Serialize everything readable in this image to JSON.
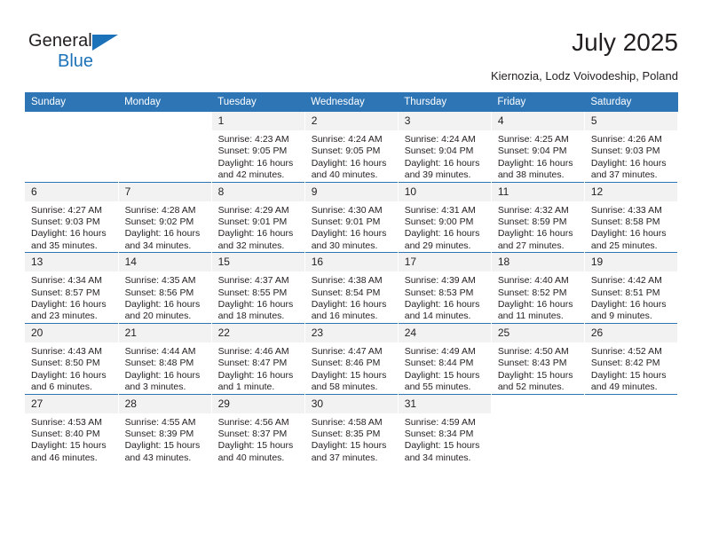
{
  "brand": {
    "name_part1": "General",
    "name_part2": "Blue",
    "accent_color": "#1b72b8",
    "triangle_icon": "brand-triangle-icon"
  },
  "header": {
    "title": "July 2025",
    "subtitle": "Kiernozia, Lodz Voivodeship, Poland"
  },
  "calendar": {
    "header_color": "#2e75b6",
    "daynum_band_color": "#f2f2f2",
    "weekdays": [
      "Sunday",
      "Monday",
      "Tuesday",
      "Wednesday",
      "Thursday",
      "Friday",
      "Saturday"
    ],
    "weeks": [
      [
        {
          "empty": true
        },
        {
          "empty": true
        },
        {
          "day": "1",
          "sunrise": "Sunrise: 4:23 AM",
          "sunset": "Sunset: 9:05 PM",
          "daylight": "Daylight: 16 hours and 42 minutes."
        },
        {
          "day": "2",
          "sunrise": "Sunrise: 4:24 AM",
          "sunset": "Sunset: 9:05 PM",
          "daylight": "Daylight: 16 hours and 40 minutes."
        },
        {
          "day": "3",
          "sunrise": "Sunrise: 4:24 AM",
          "sunset": "Sunset: 9:04 PM",
          "daylight": "Daylight: 16 hours and 39 minutes."
        },
        {
          "day": "4",
          "sunrise": "Sunrise: 4:25 AM",
          "sunset": "Sunset: 9:04 PM",
          "daylight": "Daylight: 16 hours and 38 minutes."
        },
        {
          "day": "5",
          "sunrise": "Sunrise: 4:26 AM",
          "sunset": "Sunset: 9:03 PM",
          "daylight": "Daylight: 16 hours and 37 minutes."
        }
      ],
      [
        {
          "day": "6",
          "sunrise": "Sunrise: 4:27 AM",
          "sunset": "Sunset: 9:03 PM",
          "daylight": "Daylight: 16 hours and 35 minutes."
        },
        {
          "day": "7",
          "sunrise": "Sunrise: 4:28 AM",
          "sunset": "Sunset: 9:02 PM",
          "daylight": "Daylight: 16 hours and 34 minutes."
        },
        {
          "day": "8",
          "sunrise": "Sunrise: 4:29 AM",
          "sunset": "Sunset: 9:01 PM",
          "daylight": "Daylight: 16 hours and 32 minutes."
        },
        {
          "day": "9",
          "sunrise": "Sunrise: 4:30 AM",
          "sunset": "Sunset: 9:01 PM",
          "daylight": "Daylight: 16 hours and 30 minutes."
        },
        {
          "day": "10",
          "sunrise": "Sunrise: 4:31 AM",
          "sunset": "Sunset: 9:00 PM",
          "daylight": "Daylight: 16 hours and 29 minutes."
        },
        {
          "day": "11",
          "sunrise": "Sunrise: 4:32 AM",
          "sunset": "Sunset: 8:59 PM",
          "daylight": "Daylight: 16 hours and 27 minutes."
        },
        {
          "day": "12",
          "sunrise": "Sunrise: 4:33 AM",
          "sunset": "Sunset: 8:58 PM",
          "daylight": "Daylight: 16 hours and 25 minutes."
        }
      ],
      [
        {
          "day": "13",
          "sunrise": "Sunrise: 4:34 AM",
          "sunset": "Sunset: 8:57 PM",
          "daylight": "Daylight: 16 hours and 23 minutes."
        },
        {
          "day": "14",
          "sunrise": "Sunrise: 4:35 AM",
          "sunset": "Sunset: 8:56 PM",
          "daylight": "Daylight: 16 hours and 20 minutes."
        },
        {
          "day": "15",
          "sunrise": "Sunrise: 4:37 AM",
          "sunset": "Sunset: 8:55 PM",
          "daylight": "Daylight: 16 hours and 18 minutes."
        },
        {
          "day": "16",
          "sunrise": "Sunrise: 4:38 AM",
          "sunset": "Sunset: 8:54 PM",
          "daylight": "Daylight: 16 hours and 16 minutes."
        },
        {
          "day": "17",
          "sunrise": "Sunrise: 4:39 AM",
          "sunset": "Sunset: 8:53 PM",
          "daylight": "Daylight: 16 hours and 14 minutes."
        },
        {
          "day": "18",
          "sunrise": "Sunrise: 4:40 AM",
          "sunset": "Sunset: 8:52 PM",
          "daylight": "Daylight: 16 hours and 11 minutes."
        },
        {
          "day": "19",
          "sunrise": "Sunrise: 4:42 AM",
          "sunset": "Sunset: 8:51 PM",
          "daylight": "Daylight: 16 hours and 9 minutes."
        }
      ],
      [
        {
          "day": "20",
          "sunrise": "Sunrise: 4:43 AM",
          "sunset": "Sunset: 8:50 PM",
          "daylight": "Daylight: 16 hours and 6 minutes."
        },
        {
          "day": "21",
          "sunrise": "Sunrise: 4:44 AM",
          "sunset": "Sunset: 8:48 PM",
          "daylight": "Daylight: 16 hours and 3 minutes."
        },
        {
          "day": "22",
          "sunrise": "Sunrise: 4:46 AM",
          "sunset": "Sunset: 8:47 PM",
          "daylight": "Daylight: 16 hours and 1 minute."
        },
        {
          "day": "23",
          "sunrise": "Sunrise: 4:47 AM",
          "sunset": "Sunset: 8:46 PM",
          "daylight": "Daylight: 15 hours and 58 minutes."
        },
        {
          "day": "24",
          "sunrise": "Sunrise: 4:49 AM",
          "sunset": "Sunset: 8:44 PM",
          "daylight": "Daylight: 15 hours and 55 minutes."
        },
        {
          "day": "25",
          "sunrise": "Sunrise: 4:50 AM",
          "sunset": "Sunset: 8:43 PM",
          "daylight": "Daylight: 15 hours and 52 minutes."
        },
        {
          "day": "26",
          "sunrise": "Sunrise: 4:52 AM",
          "sunset": "Sunset: 8:42 PM",
          "daylight": "Daylight: 15 hours and 49 minutes."
        }
      ],
      [
        {
          "day": "27",
          "sunrise": "Sunrise: 4:53 AM",
          "sunset": "Sunset: 8:40 PM",
          "daylight": "Daylight: 15 hours and 46 minutes."
        },
        {
          "day": "28",
          "sunrise": "Sunrise: 4:55 AM",
          "sunset": "Sunset: 8:39 PM",
          "daylight": "Daylight: 15 hours and 43 minutes."
        },
        {
          "day": "29",
          "sunrise": "Sunrise: 4:56 AM",
          "sunset": "Sunset: 8:37 PM",
          "daylight": "Daylight: 15 hours and 40 minutes."
        },
        {
          "day": "30",
          "sunrise": "Sunrise: 4:58 AM",
          "sunset": "Sunset: 8:35 PM",
          "daylight": "Daylight: 15 hours and 37 minutes."
        },
        {
          "day": "31",
          "sunrise": "Sunrise: 4:59 AM",
          "sunset": "Sunset: 8:34 PM",
          "daylight": "Daylight: 15 hours and 34 minutes."
        },
        {
          "empty": true
        },
        {
          "empty": true
        }
      ]
    ]
  }
}
